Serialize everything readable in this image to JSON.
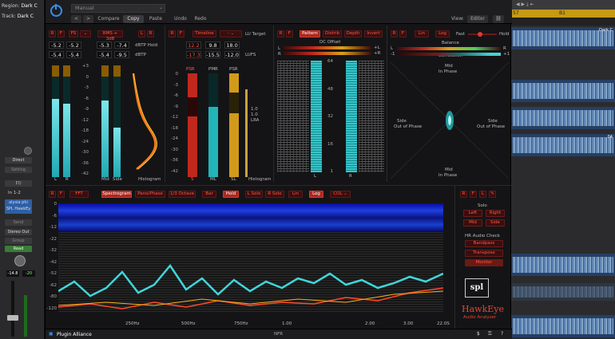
{
  "daw": {
    "region": "Region:",
    "region_val": "Dark C",
    "track": "Track:",
    "track_val": "Dark C",
    "direct": "Direct",
    "setting": "Setting",
    "eq": "EQ",
    "io": "In 1-2",
    "plugin_a": "alysia phi",
    "plugin_b": "SPL HawkEy",
    "send": "Send",
    "stereo_out": "Stereo Out",
    "group": "Group",
    "read": "Read",
    "vol": "-14.8",
    "pan": "-20",
    "ruler_a": "57",
    "ruler_b": "B1",
    "clip_label": "Dark C",
    "clip_label2": "04"
  },
  "toolbar": {
    "preset": "Manual",
    "compare": "Compare",
    "copy": "Copy",
    "paste": "Paste",
    "undo": "Undo",
    "redo": "Redo",
    "view_label": "View:",
    "view_value": "Editor"
  },
  "level": {
    "fs": "FS",
    "rms": "RMS + 3dB",
    "hold": "dBTP Hold",
    "tp": "dBTP",
    "v1": "-5.2",
    "v2": "-5.2",
    "v3": "-5.3",
    "v4": "-7.4",
    "v5": "-5.4",
    "v6": "-5.4",
    "v7": "-5.4",
    "v8": "-9.5",
    "scale": [
      "+3",
      "0",
      "-3",
      "-6",
      "-9",
      "-12",
      "-18",
      "-24",
      "-30",
      "-36",
      "-42"
    ],
    "l": "L",
    "r": "R",
    "mid": "Mid",
    "side": "Side",
    "histogram": "Histogram"
  },
  "lufs": {
    "timeline": "Timeline",
    "target": "LU Target",
    "lufs": "LUFS",
    "a1": "12.2",
    "a2": "9.8",
    "a3": "18.0",
    "b1": "-17.3",
    "b2": "-15.5",
    "b3": "-12.0",
    "psr": "PSR",
    "pmr": "PMR",
    "psr2": "PSR",
    "scale": [
      "0",
      "-3",
      "-6",
      "-9",
      "-12",
      "-18",
      "-24",
      "-30",
      "-36",
      "-42"
    ],
    "lra_a": "1.0",
    "lra_b": "1.0",
    "lra": "LRA",
    "s": "S",
    "ml": "ML",
    "sl": "SL",
    "histogram": "Histogram"
  },
  "bits": {
    "pattern": "Pattern",
    "distrib": "Distrib",
    "depth": "Depth",
    "invert": "Invert",
    "dc": "DC Offset",
    "l": "L",
    "r": "R",
    "plus_l": "+L",
    "plus_r": "+R",
    "scale": [
      "64",
      "48",
      "32",
      "16",
      "1"
    ]
  },
  "phase": {
    "lin": "Lin",
    "log": "Log",
    "fast": "Fast",
    "hold": "Hold",
    "balance": "Balance",
    "correlation": "Correlation",
    "l": "L",
    "r": "R",
    "m1": "-1",
    "p1": "+1",
    "mid_top": "Mid",
    "in_phase_top": "In Phase",
    "side_l": "Side",
    "oop_l": "Out of Phase",
    "side_r": "Side",
    "oop_r": "Out of Phase",
    "mid_bot": "Mid",
    "in_phase_bot": "In Phase"
  },
  "spec": {
    "fft": "FFT",
    "spectrogram": "Spectrogram",
    "pano": "Pano/Phase",
    "octave": "1/3 Octave",
    "bar": "Bar",
    "hold": "Hold",
    "lsolo": "L Solo",
    "rsolo": "R Solo",
    "lin": "Lin",
    "log": "Log",
    "col": "COL",
    "y": [
      "0",
      "-6",
      "-12",
      "-22",
      "-32",
      "-42",
      "-52",
      "-62",
      "-80",
      "-120"
    ],
    "x": [
      "250Hz",
      "500Hz",
      "750Hz",
      "1.00",
      "2.00",
      "3.00",
      "22.0S"
    ],
    "nfr": "NFR"
  },
  "side": {
    "solo": "Solo",
    "left": "Left",
    "right": "Right",
    "mid": "Mid",
    "side": "Side",
    "hr": "HR Audio Check",
    "bandpass": "Bandpass",
    "transpose": "Transpose",
    "monitor": "Monitor",
    "brand": "HawkEye",
    "sub": "Audio Analyzer",
    "spl": "spl"
  },
  "footer": {
    "brand": "Plugin Alliance",
    "currency": "$"
  }
}
